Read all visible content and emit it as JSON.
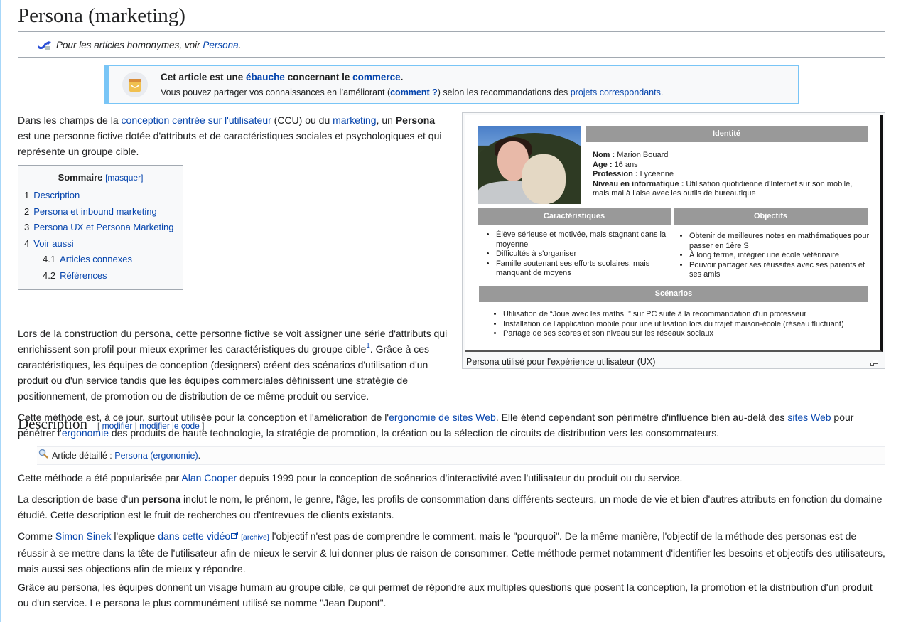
{
  "page": {
    "title": "Persona (marketing)"
  },
  "hatnote": {
    "icon": "disambiguation-icon",
    "prefix": "Pour les articles homonymes, voir ",
    "link": "Persona",
    "suffix": "."
  },
  "stub": {
    "icon": "shopping-bag-icon",
    "title_prefix": "Cet article est une ",
    "title_link1": "ébauche",
    "title_middle": " concernant le ",
    "title_link2": "commerce",
    "title_suffix": ".",
    "body_prefix": "Vous pouvez partager vos connaissances en l’améliorant (",
    "body_link1": "comment ?",
    "body_middle": ") selon les recommandations des ",
    "body_link2": "projets correspondants",
    "body_suffix": "."
  },
  "intro": {
    "t1": "Dans les champs de la ",
    "l1": "conception centrée sur l'utilisateur",
    "t2": " (CCU) ou du ",
    "l2": "marketing",
    "t3": ", un ",
    "b1": "Persona",
    "t4": " est une personne fictive dotée d'attributs et de caractéristiques sociales et psychologiques et qui représente un groupe cible."
  },
  "toc": {
    "title": "Sommaire",
    "toggle": "[masquer]",
    "items": [
      {
        "num": "1",
        "label": "Description"
      },
      {
        "num": "2",
        "label": "Persona et inbound marketing"
      },
      {
        "num": "3",
        "label": "Persona UX et Persona Marketing"
      },
      {
        "num": "4",
        "label": "Voir aussi"
      },
      {
        "num": "4.1",
        "label": "Articles connexes"
      },
      {
        "num": "4.2",
        "label": "Références"
      }
    ]
  },
  "figure": {
    "caption": "Persona utilisé pour l'expérience utilisateur (UX)",
    "enlarge_icon": "magnify-clip-icon",
    "persona": {
      "identity_header": "Identité",
      "identity": [
        {
          "key": "Nom :",
          "value": " Marion Bouard"
        },
        {
          "key": "Age :",
          "value": " 16 ans"
        },
        {
          "key": "Profession :",
          "value": " Lycéenne"
        },
        {
          "key": "Niveau en informatique :",
          "value": " Utilisation quotidienne d'Internet sur son mobile,"
        }
      ],
      "identity_continuation": "mais mal à l'aise avec les outils de bureautique",
      "characteristics_header": "Caractéristiques",
      "characteristics": [
        "Élève sérieuse et motivée, mais stagnant dans la moyenne",
        "Difficultés à s'organiser",
        "Famille soutenant ses efforts scolaires, mais manquant de moyens"
      ],
      "objectives_header": "Objectifs",
      "objectives": [
        "Obtenir de meilleures notes en mathématiques pour passer en 1ère S",
        "À long terme, intégrer une école vétérinaire",
        "Pouvoir partager ses réussites avec ses parents et ses amis"
      ],
      "scenarios_header": "Scénarios",
      "scenarios": [
        "Utilisation de “Joue avec les maths !” sur PC suite à la recommandation d'un professeur",
        "Installation de l'application mobile pour une utilisation lors du trajet maison-école (réseau fluctuant)",
        "Partage de ses scores et son niveau sur les réseaux sociaux"
      ]
    }
  },
  "description": {
    "heading": "Description",
    "edit_open": "[ ",
    "edit_link1": "modifier",
    "edit_sep": " | ",
    "edit_link2": "modifier le code",
    "edit_close": " ]",
    "p1_a": "Lors de la construction du persona, cette personne fictive se voit assigner une série d'attributs qui enrichissent son profil pour mieux exprimer les caractéristiques du groupe cible",
    "p1_ref": "1",
    "p1_b": ". Grâce à ces caractéristiques, les équipes de conception (designers) créent des scénarios d'utilisation d'un produit ou d'un service tandis que les équipes commerciales définissent une stratégie de positionnement, de promotion ou de distribution de ce même produit ou service.",
    "p2_a": "Cette méthode est, à ce jour, surtout utilisée pour la conception et l'amélioration de l'",
    "p2_l1": "ergonomie de sites Web",
    "p2_b": ". Elle étend cependant son périmètre d'influence bien au-delà des ",
    "p2_l2": "sites Web",
    "p2_c": " pour pénétrer l'",
    "p2_l3": "ergonomie",
    "p2_d": " des produits de haute technologie, la stratégie de promotion, la création ou la sélection de circuits de distribution vers les consommateurs.",
    "detail_icon": "magnifier-icon",
    "detail_prefix": "Article détaillé : ",
    "detail_link": "Persona (ergonomie)",
    "detail_suffix": ".",
    "p3_a": "Cette méthode a été popularisée par ",
    "p3_l1": "Alan Cooper",
    "p3_b": " depuis 1999 pour la conception de scénarios d'interactivité avec l'utilisateur du produit ou du service.",
    "p4_a": "La description de base d'un ",
    "p4_bold": "persona",
    "p4_b": " inclut le nom, le prénom, le genre, l'âge, les profils de consommation dans différents secteurs, un mode de vie et bien d'autres attributs en fonction du domaine étudié. Cette description est le fruit de recherches ou d'entrevues de clients existants.",
    "p5_a": "Comme ",
    "p5_l1": "Simon Sinek",
    "p5_b": " l'explique ",
    "p5_l2": "dans cette vidéo",
    "p5_archive": "[archive]",
    "p5_c": " l'objectif n'est pas de comprendre le comment, mais le \"pourquoi\". De la même manière, l'objectif de la méthode des personas est de réussir à se mettre dans la tête de l'utilisateur afin de mieux le servir & lui donner plus de raison de consommer. Cette méthode permet notamment d'identifier les besoins et objectifs des utilisateurs, mais aussi ses objections afin de mieux y répondre.",
    "p6": "Grâce au persona, les équipes donnent un visage humain au groupe cible, ce qui permet de répondre aux multiples questions que posent la conception, la promotion et la distribution d'un produit ou d'un service. Le persona le plus communément utilisé se nomme \"Jean Dupont\"."
  },
  "colors": {
    "link": "#0645ad",
    "stub_accent": "#79c5f6",
    "persona_header": "#999999"
  }
}
